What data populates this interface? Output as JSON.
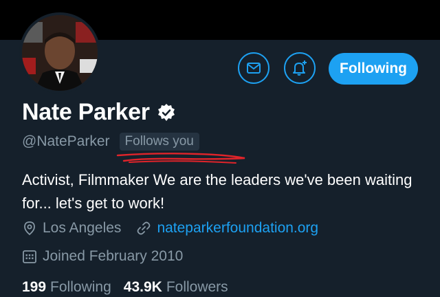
{
  "profile": {
    "display_name": "Nate Parker",
    "handle": "@NateParker",
    "follows_you_badge": "Follows you",
    "bio": "Activist, Filmmaker We are the leaders we've been waiting for... let's get to work!",
    "location": "Los Angeles",
    "website": "nateparkerfoundation.org",
    "joined": "Joined February 2010",
    "verified": true
  },
  "actions": {
    "message_icon": "envelope-icon",
    "notify_icon": "bell-plus-icon",
    "follow_label": "Following"
  },
  "stats": {
    "following_count": "199",
    "following_label": "Following",
    "followers_count": "43.9K",
    "followers_label": "Followers"
  },
  "colors": {
    "background": "#15202b",
    "accent": "#1da1f2",
    "muted_text": "#8899a6",
    "annotation_red": "#e0242a"
  }
}
